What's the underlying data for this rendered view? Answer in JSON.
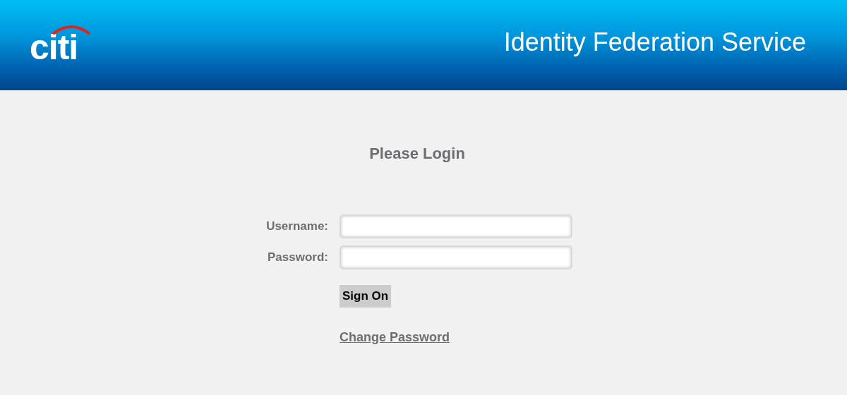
{
  "header": {
    "logo": "citi",
    "title": "Identity Federation Service"
  },
  "login": {
    "heading": "Please Login",
    "fields": [
      {
        "label": "Username:"
      },
      {
        "label": "Password:"
      }
    ],
    "button": "Sign On",
    "link": "Change Password"
  }
}
